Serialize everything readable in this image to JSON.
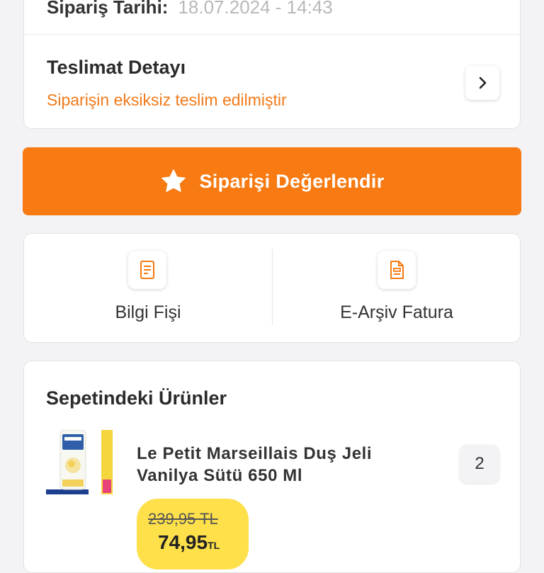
{
  "order": {
    "date_label": "Sipariş Tarihi:",
    "date_value": "18.07.2024 - 14:43",
    "delivery_title": "Teslimat Detayı",
    "delivery_status": "Siparişin eksiksiz teslim edilmiştir"
  },
  "rate_button": {
    "label": "Siparişi Değerlendir",
    "icon": "star-icon"
  },
  "documents": [
    {
      "label": "Bilgi Fişi",
      "icon": "receipt-icon"
    },
    {
      "label": "E-Arşiv Fatura",
      "icon": "invoice-icon"
    }
  ],
  "products_section": {
    "title": "Sepetindeki Ürünler",
    "items": [
      {
        "name": "Le Petit Marseillais Duş Jeli Vanilya Sütü 650 Ml",
        "quantity": "2",
        "old_price": "239,95 TL",
        "new_price": "74,95",
        "currency": "TL"
      }
    ]
  },
  "colors": {
    "accent": "#f77a12",
    "status_text": "#f27a1a",
    "price_badge": "#fde04a"
  }
}
